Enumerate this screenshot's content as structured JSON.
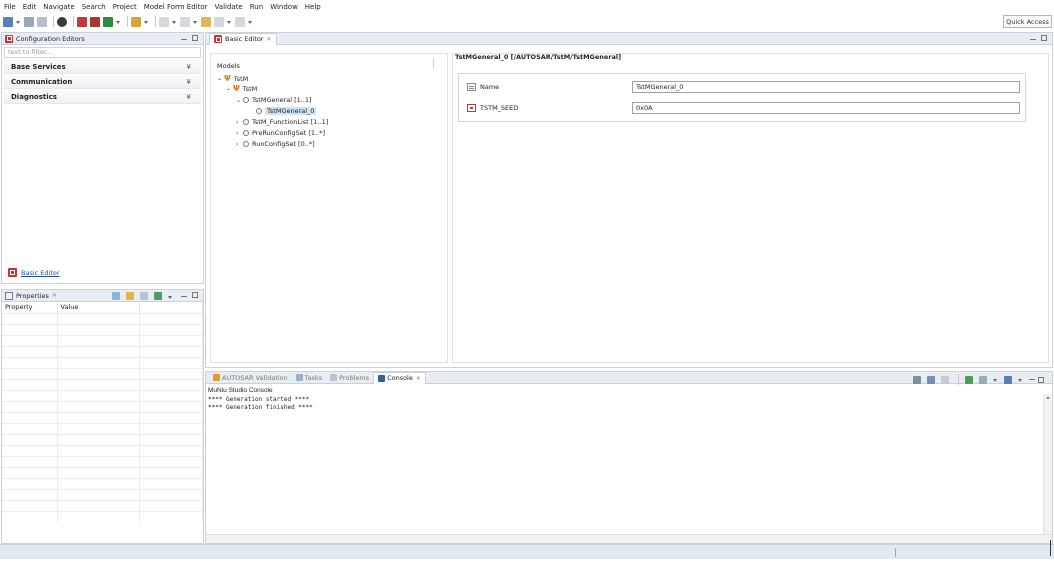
{
  "menu": [
    "File",
    "Edit",
    "Navigate",
    "Search",
    "Project",
    "Model Form Editor",
    "Validate",
    "Run",
    "Window",
    "Help"
  ],
  "quick_access": "Quick Access",
  "config_editors": {
    "title": "Configuration Editors",
    "filter_placeholder": "text to filter...",
    "categories": [
      "Base Services",
      "Communication",
      "Diagnostics"
    ],
    "link": "Basic Editor"
  },
  "properties": {
    "title": "Properties",
    "col_property": "Property",
    "col_value": "Value"
  },
  "basic_editor": {
    "tab": "Basic Editor",
    "models_label": "Models",
    "tree": {
      "root": "TstM",
      "child": "TstM",
      "general": "TstMGeneral [1..1]",
      "general_0": "TstMGeneral_0",
      "function_list": "TstM_FunctionList [1..1]",
      "pre_run": "PreRunConfigSet [1..*]",
      "run_config": "RunConfigSet [0..*]"
    },
    "form_title": "TstMGeneral_0 [/AUTOSAR/TstM/TstMGeneral]",
    "fields": [
      {
        "label": "Name",
        "value": "TstMGeneral_0"
      },
      {
        "label": "TSTM_SEED",
        "value": "0x0A"
      }
    ]
  },
  "console": {
    "tabs": [
      "AUTOSAR Validation",
      "Tasks",
      "Problems",
      "Console"
    ],
    "title": "MuNiu Studio Console",
    "lines": [
      "**** Generation started  ****",
      "**** Generation finished ****"
    ]
  }
}
